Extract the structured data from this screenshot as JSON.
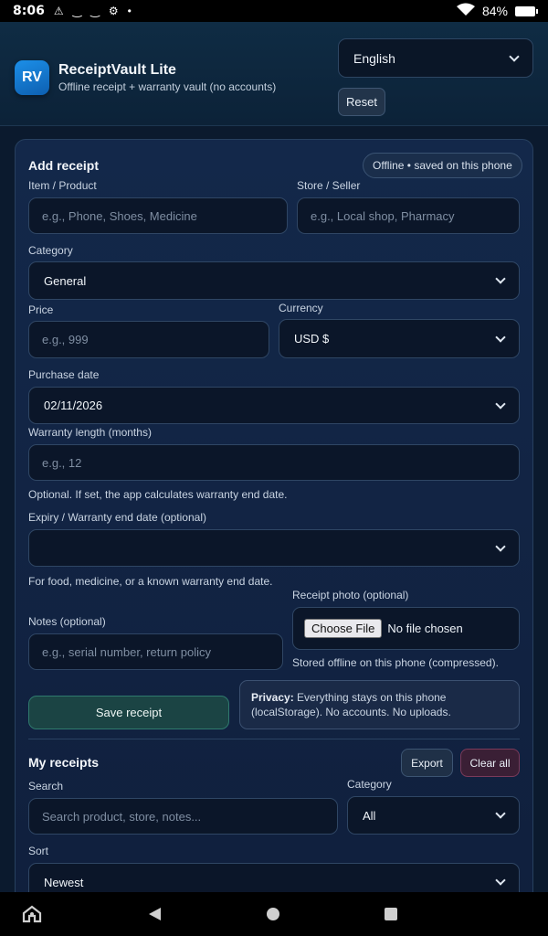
{
  "status_bar": {
    "time": "8:06",
    "battery": "84%",
    "icons": [
      "warning-icon",
      "voicemail-icon",
      "voicemail-icon",
      "settings-icon",
      "dot-icon",
      "wifi-icon",
      "battery-charging-icon"
    ]
  },
  "header": {
    "logo": "RV",
    "title": "ReceiptVault Lite",
    "subtitle": "Offline receipt + warranty vault (no accounts)",
    "language": "English",
    "reset_label": "Reset"
  },
  "add_receipt": {
    "title": "Add receipt",
    "offline_badge": "Offline • saved on this phone",
    "item_label": "Item / Product",
    "item_placeholder": "e.g., Phone, Shoes, Medicine",
    "store_label": "Store / Seller",
    "store_placeholder": "e.g., Local shop, Pharmacy",
    "category_label": "Category",
    "category_value": "General",
    "price_label": "Price",
    "price_placeholder": "e.g., 999",
    "currency_label": "Currency",
    "currency_value": "USD $",
    "purchase_date_label": "Purchase date",
    "purchase_date_value": "02/11/2026",
    "warranty_label": "Warranty length (months)",
    "warranty_placeholder": "e.g., 12",
    "warranty_help": "Optional. If set, the app calculates warranty end date.",
    "expiry_label": "Expiry / Warranty end date (optional)",
    "expiry_value": "",
    "expiry_help": "For food, medicine, or a known warranty end date.",
    "photo_label": "Receipt photo (optional)",
    "choose_file": "Choose File",
    "no_file": "No file chosen",
    "photo_help": "Stored offline on this phone (compressed).",
    "notes_label": "Notes (optional)",
    "notes_placeholder": "e.g., serial number, return policy",
    "save_label": "Save receipt",
    "privacy_title": "Privacy:",
    "privacy_text": " Everything stays on this phone (localStorage). No accounts. No uploads."
  },
  "my_receipts": {
    "title": "My receipts",
    "export_label": "Export",
    "clear_label": "Clear all",
    "search_label": "Search",
    "search_placeholder": "Search product, store, notes...",
    "category_label": "Category",
    "category_value": "All",
    "sort_label": "Sort",
    "sort_value": "Newest"
  }
}
